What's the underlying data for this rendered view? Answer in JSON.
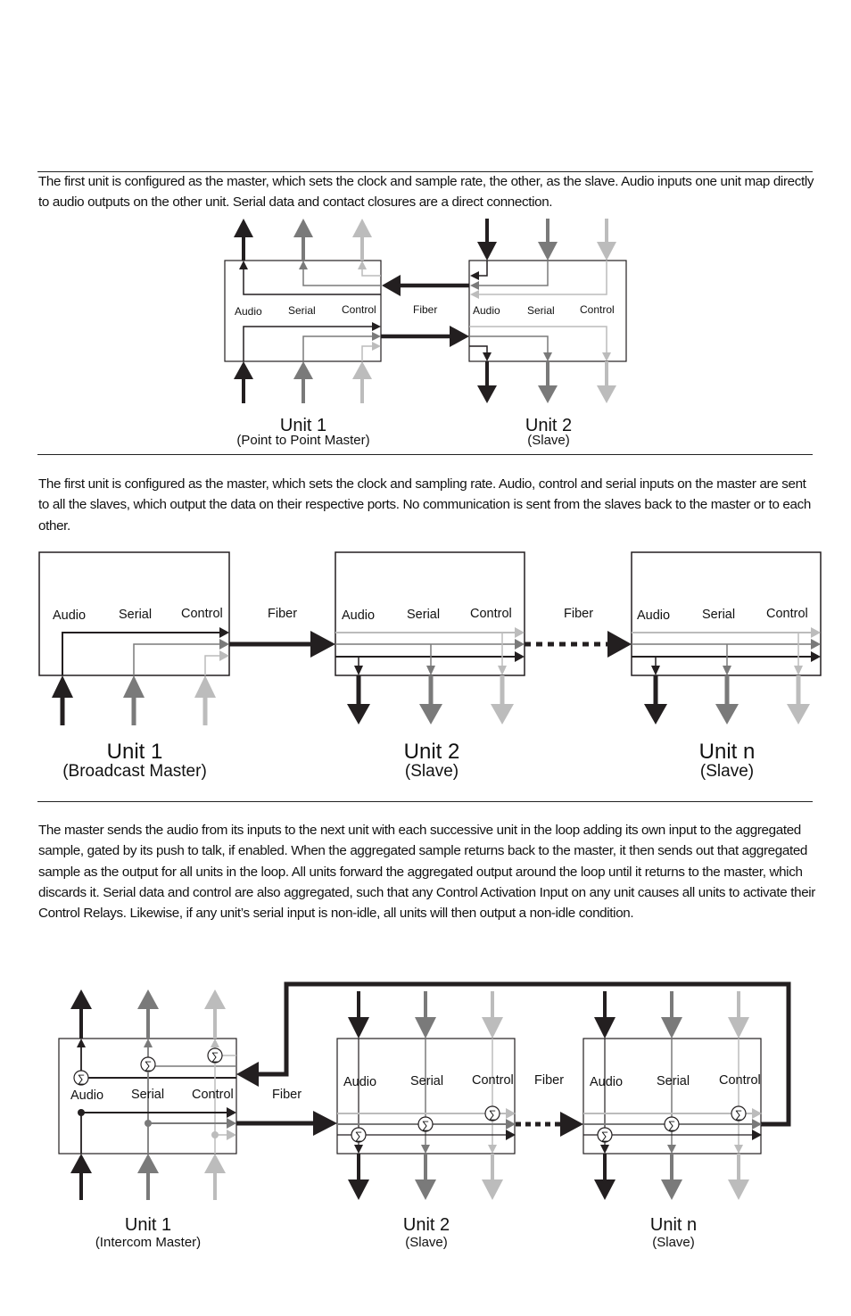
{
  "colors": {
    "audio": "#231f20",
    "serial": "#7a7a7a",
    "control": "#bcbcbc",
    "fiber": "#231f20",
    "rule": "#222222"
  },
  "sections": [
    {
      "id": "point-to-point",
      "description": "The first unit is configured as the master, which sets the clock and sample rate, the other, as the slave.  Audio inputs one unit map directly to audio outputs on the other unit. Serial data and contact closures are a direct connection.",
      "fiber_label": "Fiber",
      "units": [
        {
          "title": "Unit 1",
          "subtitle": "(Point to Point Master)",
          "ports": [
            "Audio",
            "Serial",
            "Control"
          ]
        },
        {
          "title": "Unit 2",
          "subtitle": "(Slave)",
          "ports": [
            "Audio",
            "Serial",
            "Control"
          ]
        }
      ]
    },
    {
      "id": "broadcast",
      "description": "The first unit is configured as the master, which sets the clock and sampling rate. Audio, control and serial inputs on the master are sent to all the slaves, which output the data on their respective ports. No communication is sent from the slaves back to the master or to each other.",
      "fiber_labels": [
        "Fiber",
        "Fiber"
      ],
      "units": [
        {
          "title": "Unit 1",
          "subtitle": "(Broadcast Master)",
          "ports": [
            "Audio",
            "Serial",
            "Control"
          ]
        },
        {
          "title": "Unit 2",
          "subtitle": "(Slave)",
          "ports": [
            "Audio",
            "Serial",
            "Control"
          ]
        },
        {
          "title": "Unit n",
          "subtitle": "(Slave)",
          "ports": [
            "Audio",
            "Serial",
            "Control"
          ]
        }
      ]
    },
    {
      "id": "intercom",
      "description": "The master sends the audio from its inputs to the next unit with each successive unit in the loop adding its own input to the aggregated sample, gated by its push to talk, if enabled. When the aggregated sample returns back to the master, it then sends out that aggregated sample as the output for all units in the loop. All units forward the aggregated output around the loop until it returns to the master, which discards it. Serial data and control are also aggregated, such that any Control Activation Input on any unit causes all units to activate their Control Relays. Likewise, if any unit’s serial input is non-idle, all units will then output a non-idle condition.",
      "fiber_labels": [
        "Fiber",
        "Fiber"
      ],
      "sum_symbol": "∑",
      "units": [
        {
          "title": "Unit 1",
          "subtitle": "(Intercom Master)",
          "ports": [
            "Audio",
            "Serial",
            "Control"
          ]
        },
        {
          "title": "Unit 2",
          "subtitle": "(Slave)",
          "ports": [
            "Audio",
            "Serial",
            "Control"
          ]
        },
        {
          "title": "Unit n",
          "subtitle": "(Slave)",
          "ports": [
            "Audio",
            "Serial",
            "Control"
          ]
        }
      ]
    }
  ]
}
